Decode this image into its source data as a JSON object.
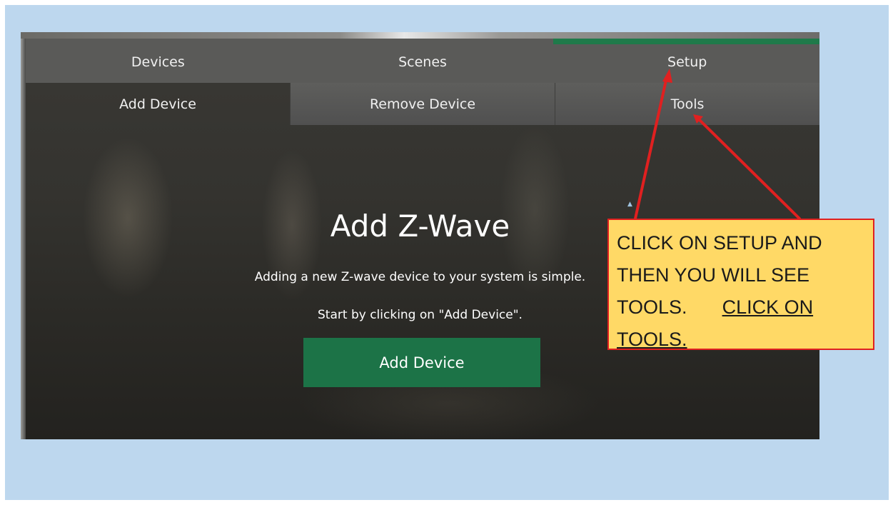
{
  "nav": {
    "tabs": [
      {
        "label": "Devices"
      },
      {
        "label": "Scenes"
      },
      {
        "label": "Setup"
      }
    ]
  },
  "subnav": {
    "tabs": [
      {
        "label": "Add Device"
      },
      {
        "label": "Remove Device"
      },
      {
        "label": "Tools"
      }
    ]
  },
  "main": {
    "title": "Add Z-Wave",
    "description_1": "Adding a new Z-wave device to your system is simple.",
    "description_2": "Start by clicking on \"Add Device\".",
    "button_label": "Add Device"
  },
  "callout": {
    "line_1": "CLICK ON SETUP AND",
    "line_2": "THEN YOU WILL SEE",
    "line_3_plain": "TOOLS.",
    "line_3_underlined": "CLICK ON",
    "line_4_underlined": "TOOLS."
  },
  "colors": {
    "slide_background": "#bdd7ee",
    "accent_green": "#1c7347",
    "callout_fill": "#ffd966",
    "callout_border": "#e02020",
    "arrow": "#e02020"
  }
}
